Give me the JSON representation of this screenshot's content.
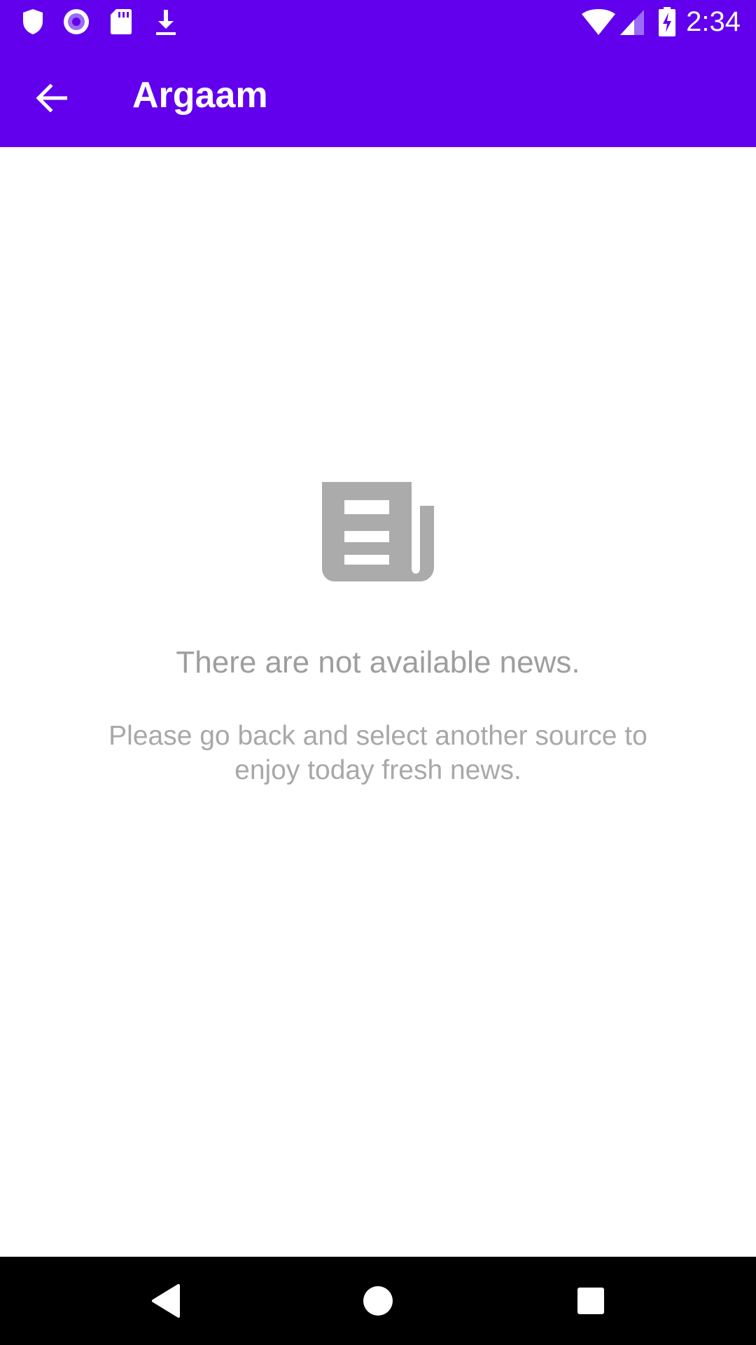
{
  "status_bar": {
    "time": "2:34",
    "left_icons": [
      "shield-icon",
      "circle-dot-icon",
      "sd-card-icon",
      "download-icon"
    ],
    "right_icons": [
      "wifi-icon",
      "cell-signal-icon",
      "battery-charging-icon"
    ]
  },
  "app_bar": {
    "title": "Argaam",
    "back_icon": "arrow-back-icon"
  },
  "empty_state": {
    "icon": "newspaper-icon",
    "title": "There are not available news.",
    "subtitle": "Please go back and select another source to enjoy today fresh news."
  },
  "nav_bar": {
    "buttons": [
      "back-triangle-icon",
      "home-circle-icon",
      "recents-square-icon"
    ]
  },
  "colors": {
    "primary": "#6200EE",
    "empty_text": "#9e9e9e",
    "icon_gray": "#ababab",
    "nav_bar": "#000000"
  }
}
